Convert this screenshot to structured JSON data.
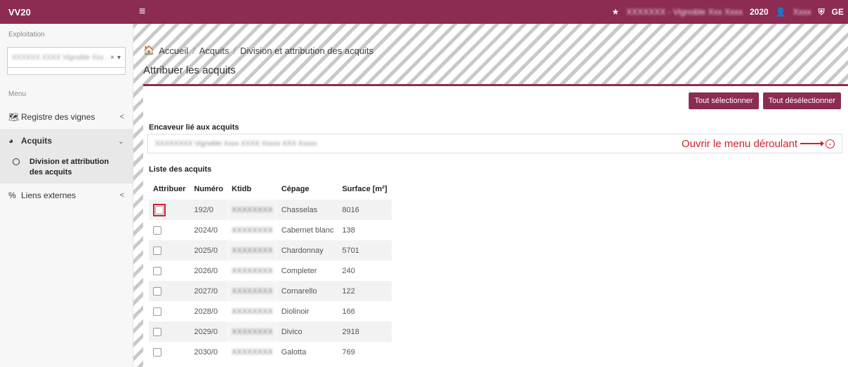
{
  "topbar": {
    "brand": "VV20",
    "menu_icon": "hamburger-icon",
    "exploitation_name": "XXXXXXX - Vignoble Xxx Xxxx",
    "year": "2020",
    "user": "Xxxx",
    "lang": "GE"
  },
  "sidebar": {
    "exploitation_label": "Exploitation",
    "exploitation_value": "XXXXXX XXXX Vignoble Xxx ...",
    "menu_label": "Menu",
    "items": [
      {
        "label": "Registre des vignes",
        "icon": "map-icon",
        "chevron": "<"
      },
      {
        "label": "Acquits",
        "icon": "globe-icon",
        "chevron": "⌄"
      },
      {
        "label": "Division et attribution des acquits",
        "icon": "circle-icon"
      },
      {
        "label": "Liens externes",
        "icon": "link-icon",
        "chevron": "<"
      }
    ]
  },
  "breadcrumb": {
    "home": "Accueil",
    "level2": "Acquits",
    "level3": "Division et attribution des acquits"
  },
  "page_title": "Attribuer les acquits",
  "buttons": {
    "select_all": "Tout sélectionner",
    "deselect_all": "Tout désélectionner"
  },
  "encaveur": {
    "label": "Encaveur lié aux acquits",
    "value": "XXXXXXXX Vignoble Xxxx XXXX Xxxxx XXX Xxxxx",
    "annotation": "Ouvrir le menu déroulant"
  },
  "table": {
    "title": "Liste des acquits",
    "headers": [
      "Attribuer",
      "Numéro",
      "Ktidb",
      "Cépage",
      "Surface [m²]"
    ],
    "rows": [
      {
        "numero": "192/0",
        "ktidb": "XXXXXXXX",
        "cepage": "Chasselas",
        "surface": "8016"
      },
      {
        "numero": "2024/0",
        "ktidb": "XXXXXXXX",
        "cepage": "Cabernet blanc",
        "surface": "138"
      },
      {
        "numero": "2025/0",
        "ktidb": "XXXXXXXX",
        "cepage": "Chardonnay",
        "surface": "5701"
      },
      {
        "numero": "2026/0",
        "ktidb": "XXXXXXXX",
        "cepage": "Completer",
        "surface": "240"
      },
      {
        "numero": "2027/0",
        "ktidb": "XXXXXXXX",
        "cepage": "Cornarello",
        "surface": "122"
      },
      {
        "numero": "2028/0",
        "ktidb": "XXXXXXXX",
        "cepage": "Diolinoir",
        "surface": "166"
      },
      {
        "numero": "2029/0",
        "ktidb": "XXXXXXXX",
        "cepage": "Divico",
        "surface": "2918"
      },
      {
        "numero": "2030/0",
        "ktidb": "XXXXXXXX",
        "cepage": "Galotta",
        "surface": "769"
      }
    ]
  },
  "colors": {
    "brand": "#8c2c52",
    "annotation": "#d0202a"
  }
}
